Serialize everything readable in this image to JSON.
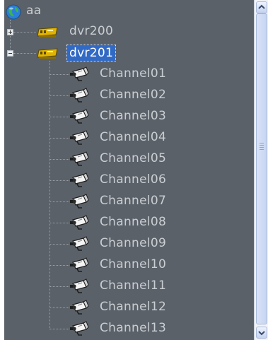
{
  "tree": {
    "root": {
      "label": "aa",
      "icon": "globe-icon"
    },
    "devices": [
      {
        "label": "dvr200",
        "expanded": false,
        "selected": false,
        "icon": "dvr-device-icon"
      },
      {
        "label": "dvr201",
        "expanded": true,
        "selected": true,
        "icon": "dvr-device-icon"
      }
    ],
    "channels": [
      "Channel01",
      "Channel02",
      "Channel03",
      "Channel04",
      "Channel05",
      "Channel06",
      "Channel07",
      "Channel08",
      "Channel09",
      "Channel10",
      "Channel11",
      "Channel12",
      "Channel13"
    ],
    "channel_icon": "camera-icon"
  },
  "scrollbar": {
    "up_icon": "chevron-up-icon",
    "down_icon": "chevron-down-icon"
  },
  "colors": {
    "panel_bg": "#5b6168",
    "text": "#c9ced3",
    "selection": "#316ac5"
  }
}
